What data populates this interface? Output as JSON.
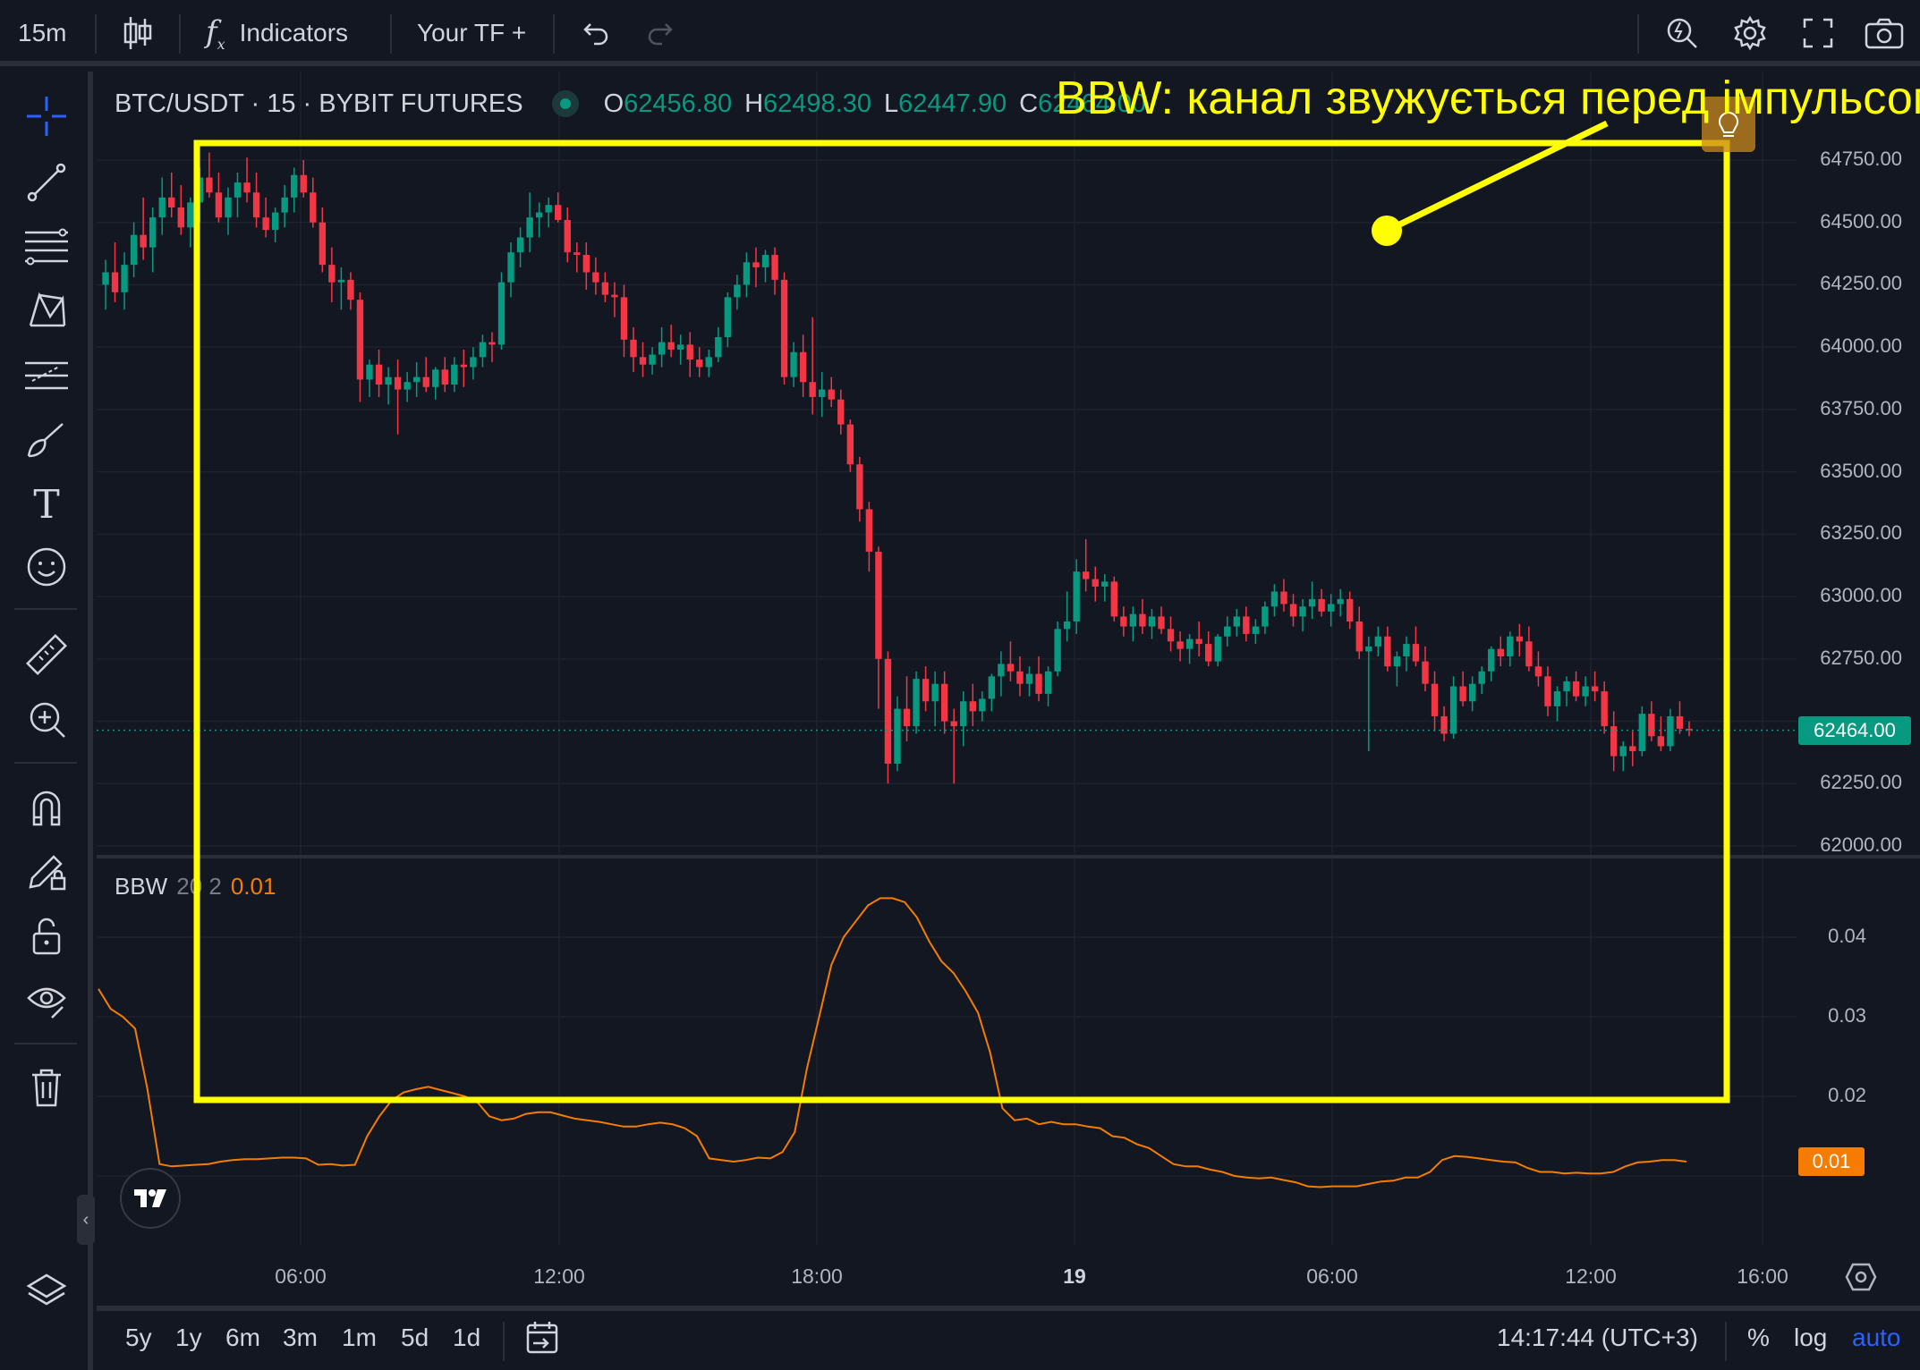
{
  "toolbar": {
    "interval": "15m",
    "indicators_label": "Indicators",
    "your_tf_label": "Your TF +"
  },
  "legend": {
    "symbol": "BTC/USDT · 15 · BYBIT FUTURES",
    "o_label": "O",
    "o_value": "62456.80",
    "h_label": "H",
    "h_value": "62498.30",
    "l_label": "L",
    "l_value": "62447.90",
    "c_label": "C",
    "c_value": "62464.00"
  },
  "price_axis": {
    "labels": [
      "64750.00",
      "64500.00",
      "64250.00",
      "64000.00",
      "63750.00",
      "63500.00",
      "63250.00",
      "63000.00",
      "62750.00",
      "62250.00",
      "62000.00"
    ],
    "current_price": "62464.00",
    "current_color": "#089981"
  },
  "bbw": {
    "name": "BBW",
    "params": "20 2",
    "value": "0.01",
    "color": "#f57c00",
    "axis_labels": [
      "0.04",
      "0.03",
      "0.02"
    ],
    "current_value": "0.01"
  },
  "time_axis": {
    "labels": [
      "06:00",
      "12:00",
      "18:00",
      "19",
      "06:00",
      "12:00",
      "16:00"
    ]
  },
  "annotation": {
    "text": "BBW: канал звужується перед імпульсом",
    "color": "#ffff00"
  },
  "bottombar": {
    "ranges": [
      "5y",
      "1y",
      "6m",
      "3m",
      "1m",
      "5d",
      "1d"
    ],
    "clock": "14:17:44 (UTC+3)",
    "percent_label": "%",
    "log_label": "log",
    "auto_label": "auto"
  },
  "colors": {
    "up": "#089981",
    "down": "#f23645",
    "background": "#131722",
    "grid": "#1e222d"
  },
  "chart_data": {
    "type": "candlestick",
    "title": "BTC/USDT · 15 · BYBIT FUTURES",
    "ylim": [
      62000,
      64800
    ],
    "candles": [
      [
        64250,
        64350,
        64150,
        64300
      ],
      [
        64300,
        64420,
        64180,
        64220
      ],
      [
        64220,
        64380,
        64150,
        64330
      ],
      [
        64330,
        64500,
        64280,
        64450
      ],
      [
        64450,
        64600,
        64350,
        64400
      ],
      [
        64400,
        64560,
        64300,
        64520
      ],
      [
        64520,
        64680,
        64450,
        64600
      ],
      [
        64600,
        64700,
        64520,
        64560
      ],
      [
        64560,
        64650,
        64450,
        64480
      ],
      [
        64480,
        64600,
        64400,
        64580
      ],
      [
        64580,
        64720,
        64500,
        64680
      ],
      [
        64680,
        64780,
        64600,
        64620
      ],
      [
        64620,
        64700,
        64500,
        64520
      ],
      [
        64520,
        64640,
        64450,
        64600
      ],
      [
        64600,
        64700,
        64520,
        64660
      ],
      [
        64660,
        64760,
        64580,
        64620
      ],
      [
        64620,
        64700,
        64480,
        64520
      ],
      [
        64520,
        64600,
        64440,
        64470
      ],
      [
        64470,
        64560,
        64420,
        64540
      ],
      [
        64540,
        64650,
        64480,
        64600
      ],
      [
        64600,
        64720,
        64540,
        64690
      ],
      [
        64690,
        64750,
        64600,
        64620
      ],
      [
        64620,
        64680,
        64480,
        64500
      ],
      [
        64500,
        64560,
        64300,
        64330
      ],
      [
        64330,
        64400,
        64180,
        64260
      ],
      [
        64260,
        64320,
        64150,
        64270
      ],
      [
        64270,
        64300,
        64150,
        64190
      ],
      [
        64190,
        64220,
        63780,
        63870
      ],
      [
        63870,
        63950,
        63800,
        63930
      ],
      [
        63930,
        63990,
        63800,
        63850
      ],
      [
        63850,
        63920,
        63770,
        63880
      ],
      [
        63880,
        63950,
        63650,
        63830
      ],
      [
        63830,
        63900,
        63780,
        63860
      ],
      [
        63860,
        63940,
        63800,
        63880
      ],
      [
        63880,
        63960,
        63820,
        63840
      ],
      [
        63840,
        63920,
        63790,
        63910
      ],
      [
        63910,
        63960,
        63820,
        63850
      ],
      [
        63850,
        63960,
        63820,
        63930
      ],
      [
        63930,
        63990,
        63840,
        63920
      ],
      [
        63920,
        64000,
        63870,
        63960
      ],
      [
        63960,
        64050,
        63920,
        64020
      ],
      [
        64020,
        64060,
        63940,
        64010
      ],
      [
        64010,
        64300,
        63990,
        64260
      ],
      [
        64260,
        64420,
        64200,
        64380
      ],
      [
        64380,
        64480,
        64320,
        64440
      ],
      [
        64440,
        64620,
        64380,
        64520
      ],
      [
        64520,
        64580,
        64440,
        64540
      ],
      [
        64540,
        64600,
        64480,
        64570
      ],
      [
        64570,
        64620,
        64500,
        64510
      ],
      [
        64510,
        64560,
        64340,
        64380
      ],
      [
        64380,
        64420,
        64300,
        64370
      ],
      [
        64370,
        64420,
        64230,
        64300
      ],
      [
        64300,
        64360,
        64210,
        64260
      ],
      [
        64260,
        64300,
        64180,
        64210
      ],
      [
        64210,
        64260,
        64120,
        64200
      ],
      [
        64200,
        64250,
        63960,
        64030
      ],
      [
        64030,
        64080,
        63900,
        63960
      ],
      [
        63960,
        64020,
        63880,
        63930
      ],
      [
        63930,
        64000,
        63890,
        63970
      ],
      [
        63970,
        64080,
        63920,
        64020
      ],
      [
        64020,
        64090,
        63960,
        63990
      ],
      [
        63990,
        64050,
        63930,
        64010
      ],
      [
        64010,
        64060,
        63880,
        63950
      ],
      [
        63950,
        64000,
        63880,
        63920
      ],
      [
        63920,
        63990,
        63880,
        63960
      ],
      [
        63960,
        64080,
        63940,
        64040
      ],
      [
        64040,
        64220,
        64000,
        64200
      ],
      [
        64200,
        64290,
        64150,
        64250
      ],
      [
        64250,
        64380,
        64200,
        64340
      ],
      [
        64340,
        64400,
        64240,
        64320
      ],
      [
        64320,
        64390,
        64260,
        64370
      ],
      [
        64370,
        64400,
        64210,
        64270
      ],
      [
        64270,
        64300,
        63850,
        63880
      ],
      [
        63880,
        64020,
        63840,
        63980
      ],
      [
        63980,
        64050,
        63800,
        63860
      ],
      [
        63860,
        64120,
        63730,
        63800
      ],
      [
        63800,
        63900,
        63720,
        63830
      ],
      [
        63830,
        63880,
        63760,
        63790
      ],
      [
        63790,
        63830,
        63650,
        63690
      ],
      [
        63690,
        63710,
        63500,
        63530
      ],
      [
        63530,
        63560,
        63300,
        63350
      ],
      [
        63350,
        63380,
        63100,
        63180
      ],
      [
        63180,
        63200,
        62550,
        62750
      ],
      [
        62750,
        62780,
        62250,
        62330
      ],
      [
        62330,
        62600,
        62300,
        62550
      ],
      [
        62550,
        62680,
        62420,
        62480
      ],
      [
        62480,
        62700,
        62450,
        62670
      ],
      [
        62670,
        62720,
        62540,
        62580
      ],
      [
        62580,
        62700,
        62480,
        62650
      ],
      [
        62650,
        62700,
        62450,
        62500
      ],
      [
        62500,
        62550,
        62250,
        62480
      ],
      [
        62480,
        62620,
        62400,
        62580
      ],
      [
        62580,
        62650,
        62480,
        62540
      ],
      [
        62540,
        62620,
        62500,
        62590
      ],
      [
        62590,
        62690,
        62540,
        62680
      ],
      [
        62680,
        62780,
        62600,
        62730
      ],
      [
        62730,
        62820,
        62660,
        62700
      ],
      [
        62700,
        62760,
        62600,
        62650
      ],
      [
        62650,
        62720,
        62600,
        62690
      ],
      [
        62690,
        62760,
        62580,
        62610
      ],
      [
        62610,
        62720,
        62560,
        62700
      ],
      [
        62700,
        62900,
        62680,
        62870
      ],
      [
        62870,
        63020,
        62820,
        62900
      ],
      [
        62900,
        63150,
        62850,
        63100
      ],
      [
        63100,
        63230,
        63020,
        63070
      ],
      [
        63070,
        63120,
        62980,
        63040
      ],
      [
        63040,
        63090,
        62980,
        63060
      ],
      [
        63060,
        63080,
        62900,
        62920
      ],
      [
        62920,
        62960,
        62840,
        62880
      ],
      [
        62880,
        62960,
        62820,
        62930
      ],
      [
        62930,
        62990,
        62850,
        62880
      ],
      [
        62880,
        62950,
        62830,
        62920
      ],
      [
        62920,
        62960,
        62850,
        62870
      ],
      [
        62870,
        62920,
        62780,
        62820
      ],
      [
        62820,
        62860,
        62740,
        62790
      ],
      [
        62790,
        62850,
        62730,
        62830
      ],
      [
        62830,
        62900,
        62760,
        62810
      ],
      [
        62810,
        62860,
        62720,
        62740
      ],
      [
        62740,
        62850,
        62720,
        62840
      ],
      [
        62840,
        62920,
        62800,
        62880
      ],
      [
        62880,
        62950,
        62840,
        62920
      ],
      [
        62920,
        62960,
        62820,
        62850
      ],
      [
        62850,
        62910,
        62810,
        62880
      ],
      [
        62880,
        62980,
        62850,
        62960
      ],
      [
        62960,
        63050,
        62920,
        63020
      ],
      [
        63020,
        63070,
        62940,
        62970
      ],
      [
        62970,
        63010,
        62880,
        62920
      ],
      [
        62920,
        62990,
        62860,
        62960
      ],
      [
        62960,
        63060,
        62910,
        62990
      ],
      [
        62990,
        63030,
        62920,
        62940
      ],
      [
        62940,
        63010,
        62880,
        62970
      ],
      [
        62970,
        63030,
        62920,
        62990
      ],
      [
        62990,
        63020,
        62870,
        62900
      ],
      [
        62900,
        62960,
        62750,
        62780
      ],
      [
        62780,
        62840,
        62380,
        62800
      ],
      [
        62800,
        62880,
        62760,
        62840
      ],
      [
        62840,
        62880,
        62700,
        62720
      ],
      [
        62720,
        62780,
        62640,
        62760
      ],
      [
        62760,
        62840,
        62700,
        62810
      ],
      [
        62810,
        62880,
        62720,
        62740
      ],
      [
        62740,
        62800,
        62620,
        62650
      ],
      [
        62650,
        62700,
        62460,
        62520
      ],
      [
        62520,
        62560,
        62420,
        62450
      ],
      [
        62450,
        62680,
        62430,
        62640
      ],
      [
        62640,
        62700,
        62560,
        62580
      ],
      [
        62580,
        62680,
        62540,
        62650
      ],
      [
        62650,
        62720,
        62610,
        62700
      ],
      [
        62700,
        62800,
        62660,
        62790
      ],
      [
        62790,
        62840,
        62720,
        62760
      ],
      [
        62760,
        62860,
        62720,
        62840
      ],
      [
        62840,
        62890,
        62760,
        62820
      ],
      [
        62820,
        62880,
        62700,
        62720
      ],
      [
        62720,
        62780,
        62640,
        62680
      ],
      [
        62680,
        62720,
        62520,
        62560
      ],
      [
        62560,
        62640,
        62500,
        62620
      ],
      [
        62620,
        62680,
        62560,
        62660
      ],
      [
        62660,
        62700,
        62580,
        62600
      ],
      [
        62600,
        62680,
        62560,
        62640
      ],
      [
        62640,
        62700,
        62580,
        62620
      ],
      [
        62620,
        62660,
        62450,
        62480
      ],
      [
        62480,
        62540,
        62300,
        62360
      ],
      [
        62360,
        62420,
        62300,
        62400
      ],
      [
        62400,
        62460,
        62320,
        62380
      ],
      [
        62380,
        62560,
        62360,
        62530
      ],
      [
        62530,
        62580,
        62420,
        62440
      ],
      [
        62440,
        62520,
        62380,
        62400
      ],
      [
        62400,
        62550,
        62380,
        62520
      ],
      [
        62520,
        62580,
        62450,
        62470
      ],
      [
        62470,
        62500,
        62440,
        62464
      ]
    ],
    "bbw_series": [
      0.0335,
      0.031,
      0.03,
      0.0285,
      0.021,
      0.0115,
      0.0112,
      0.0113,
      0.0114,
      0.0115,
      0.0118,
      0.012,
      0.0121,
      0.0121,
      0.0122,
      0.0123,
      0.0123,
      0.0122,
      0.0114,
      0.0115,
      0.0113,
      0.0114,
      0.015,
      0.0175,
      0.0195,
      0.0205,
      0.0209,
      0.0212,
      0.0208,
      0.0204,
      0.02,
      0.0193,
      0.0175,
      0.017,
      0.0172,
      0.0178,
      0.018,
      0.018,
      0.0176,
      0.0172,
      0.017,
      0.0168,
      0.0165,
      0.0162,
      0.0162,
      0.0165,
      0.0167,
      0.0165,
      0.016,
      0.015,
      0.0122,
      0.012,
      0.0118,
      0.012,
      0.0123,
      0.0122,
      0.013,
      0.0155,
      0.0235,
      0.03,
      0.0365,
      0.04,
      0.042,
      0.044,
      0.0449,
      0.0449,
      0.0444,
      0.0425,
      0.0395,
      0.037,
      0.0355,
      0.0332,
      0.0305,
      0.0255,
      0.0185,
      0.017,
      0.0172,
      0.0165,
      0.0168,
      0.0165,
      0.0165,
      0.0162,
      0.016,
      0.015,
      0.0148,
      0.014,
      0.0135,
      0.0125,
      0.0115,
      0.0112,
      0.0112,
      0.0108,
      0.0105,
      0.01,
      0.0098,
      0.0097,
      0.0098,
      0.0095,
      0.0092,
      0.0087,
      0.0086,
      0.0087,
      0.0087,
      0.0087,
      0.009,
      0.0093,
      0.0094,
      0.0098,
      0.0098,
      0.0105,
      0.012,
      0.0125,
      0.0124,
      0.0122,
      0.012,
      0.0118,
      0.0117,
      0.011,
      0.0105,
      0.0105,
      0.0103,
      0.0104,
      0.0103,
      0.0103,
      0.0105,
      0.0112,
      0.0117,
      0.0118,
      0.012,
      0.012,
      0.0118
    ],
    "bbw_ylim": [
      0.005,
      0.047
    ]
  }
}
